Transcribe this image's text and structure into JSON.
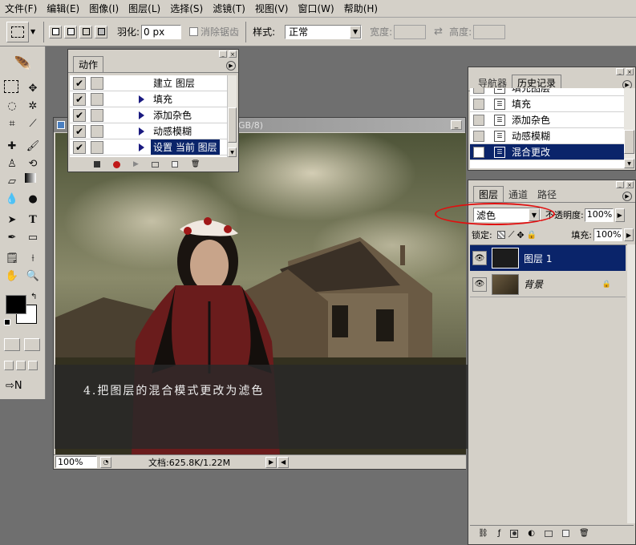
{
  "menu": [
    "文件(F)",
    "编辑(E)",
    "图像(I)",
    "图层(L)",
    "选择(S)",
    "滤镜(T)",
    "视图(V)",
    "窗口(W)",
    "帮助(H)"
  ],
  "options": {
    "feather_label": "羽化:",
    "feather_value": "0 px",
    "antialias_label": "消除锯齿",
    "style_label": "样式:",
    "style_value": "正常",
    "width_label": "宽度:",
    "height_label": "高度:"
  },
  "actions_panel": {
    "tab": "动作",
    "items": [
      {
        "label": "建立 图层",
        "selected": false
      },
      {
        "label": "填充",
        "selected": false
      },
      {
        "label": "添加杂色",
        "selected": false
      },
      {
        "label": "动感模糊",
        "selected": false
      },
      {
        "label": "设置 当前 图层",
        "selected": true
      }
    ]
  },
  "history_panel": {
    "tabs": [
      "导航器",
      "历史记录"
    ],
    "items": [
      {
        "label": "填充图层",
        "selected": false
      },
      {
        "label": "填充",
        "selected": false
      },
      {
        "label": "添加杂色",
        "selected": false
      },
      {
        "label": "动感模糊",
        "selected": false
      },
      {
        "label": "混合更改",
        "selected": true
      }
    ]
  },
  "layers_panel": {
    "tabs": [
      "图层",
      "通道",
      "路径"
    ],
    "blend_mode": "滤色",
    "opacity_label": "不透明度:",
    "opacity_value": "100%",
    "lock_label": "锁定:",
    "fill_label": "填充:",
    "fill_value": "100%",
    "layers": [
      {
        "name": "图层 1",
        "selected": true
      },
      {
        "name": "背景",
        "selected": false,
        "locked": true
      }
    ]
  },
  "document": {
    "title_fragment": "GB/8)",
    "zoom": "100%",
    "status": "文档:625.8K/1.22M"
  },
  "caption": "4.把图层的混合模式更改为滤色",
  "colors": {
    "selection": "#0a246a",
    "chrome": "#d4d0c8",
    "annotation_circle": "#e01010"
  }
}
